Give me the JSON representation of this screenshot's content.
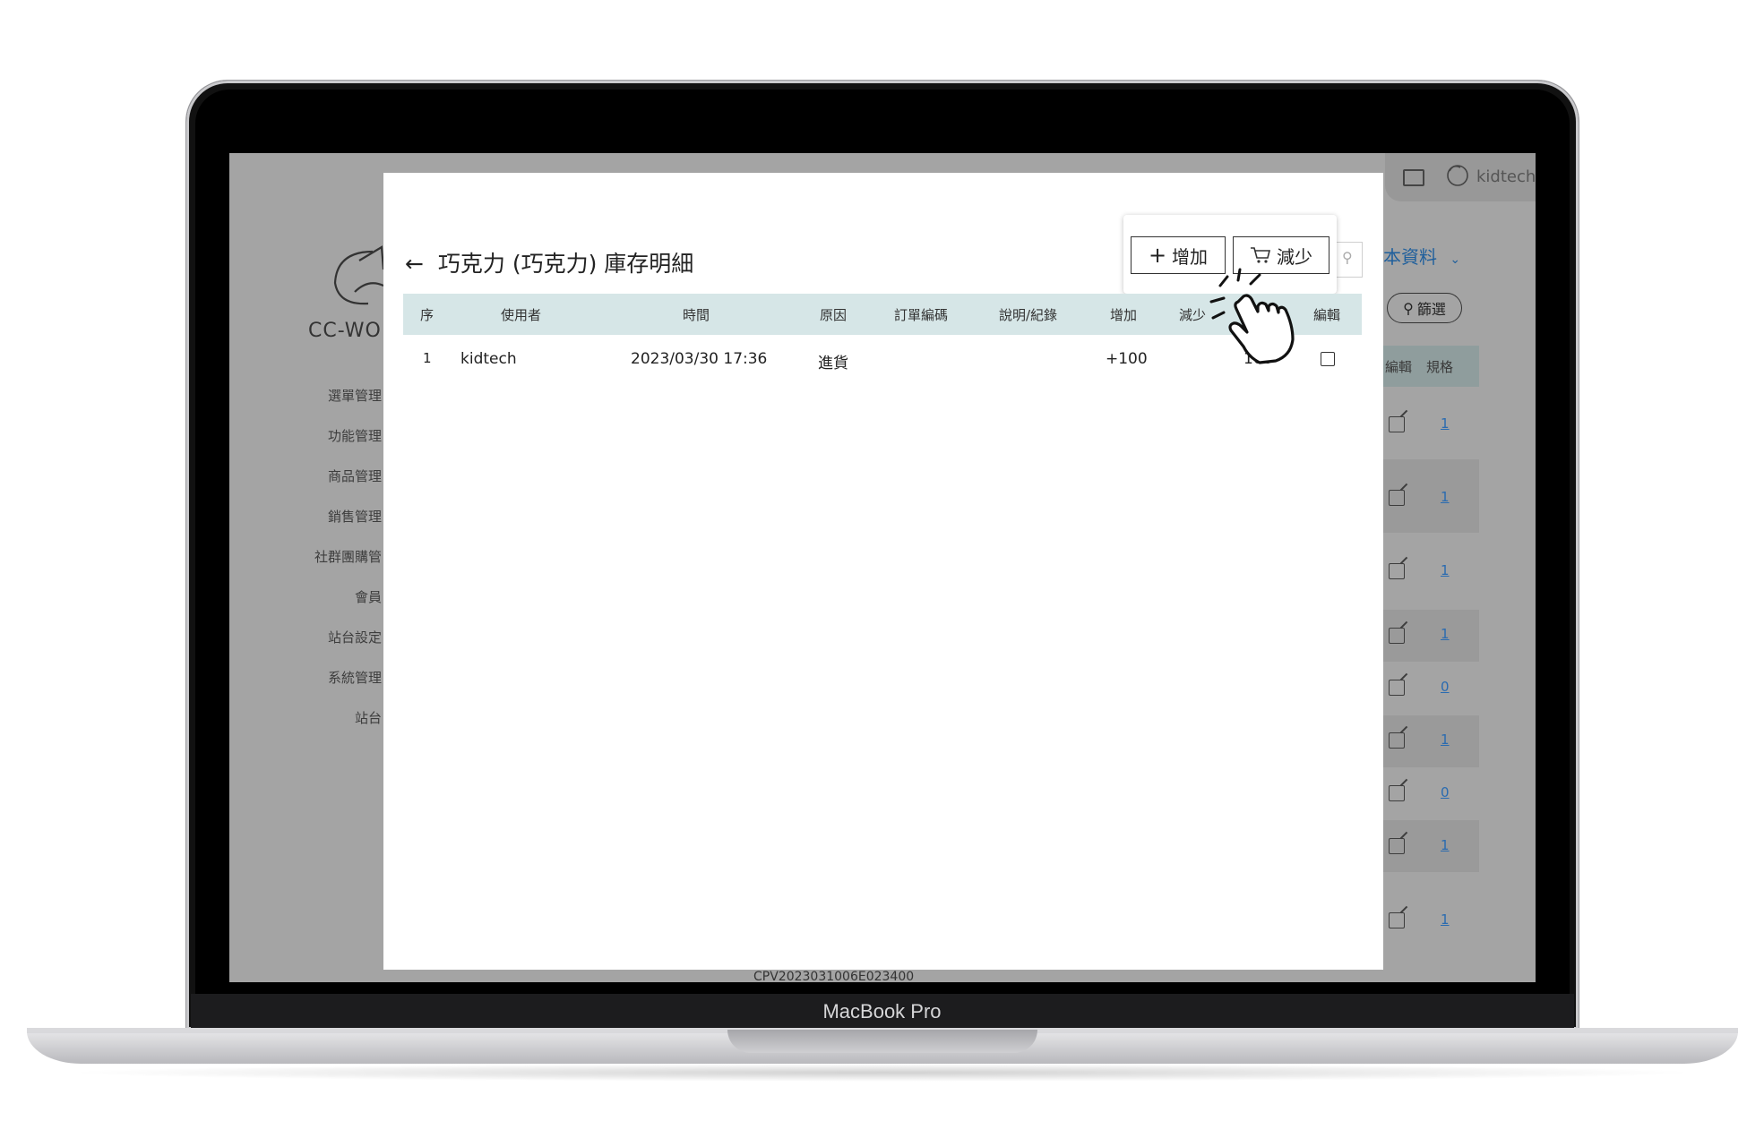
{
  "device": {
    "label": "MacBook Pro"
  },
  "background_app": {
    "logo_text": "CC-WO",
    "sidebar": [
      "選單管理",
      "功能管理",
      "商品管理",
      "銷售管理",
      "社群團購管",
      "會員",
      "站台設定",
      "系統管理",
      "站台"
    ],
    "top_user": "kidtech",
    "section_title": "本資料",
    "filter_label": "篩選",
    "table_headers": [
      "編輯",
      "規格"
    ],
    "spec_values": [
      "1",
      "1",
      "1",
      "1",
      "0",
      "1",
      "0",
      "1",
      "1"
    ],
    "footer_text": "CPV2023031006E023400"
  },
  "modal": {
    "back_arrow": "←",
    "title": "巧克力 (巧克力) 庫存明細",
    "add_button": "增加",
    "reduce_button": "減少",
    "columns": [
      "序",
      "使用者",
      "時間",
      "原因",
      "訂單編碼",
      "說明/紀錄",
      "增加",
      "減少",
      "數量",
      "編輯"
    ],
    "rows": [
      {
        "index": "1",
        "user": "kidtech",
        "time": "2023/03/30 17:36",
        "reason": "進貨",
        "order_code": "",
        "note": "",
        "increase": "+100",
        "decrease": "",
        "quantity": "100"
      }
    ]
  },
  "icons": [
    "back-arrow-icon",
    "plus-icon",
    "cart-icon",
    "search-icon",
    "edit-icon",
    "pointer-hand-icon",
    "chat-icon",
    "avatar-icon",
    "chevron-down-icon"
  ]
}
